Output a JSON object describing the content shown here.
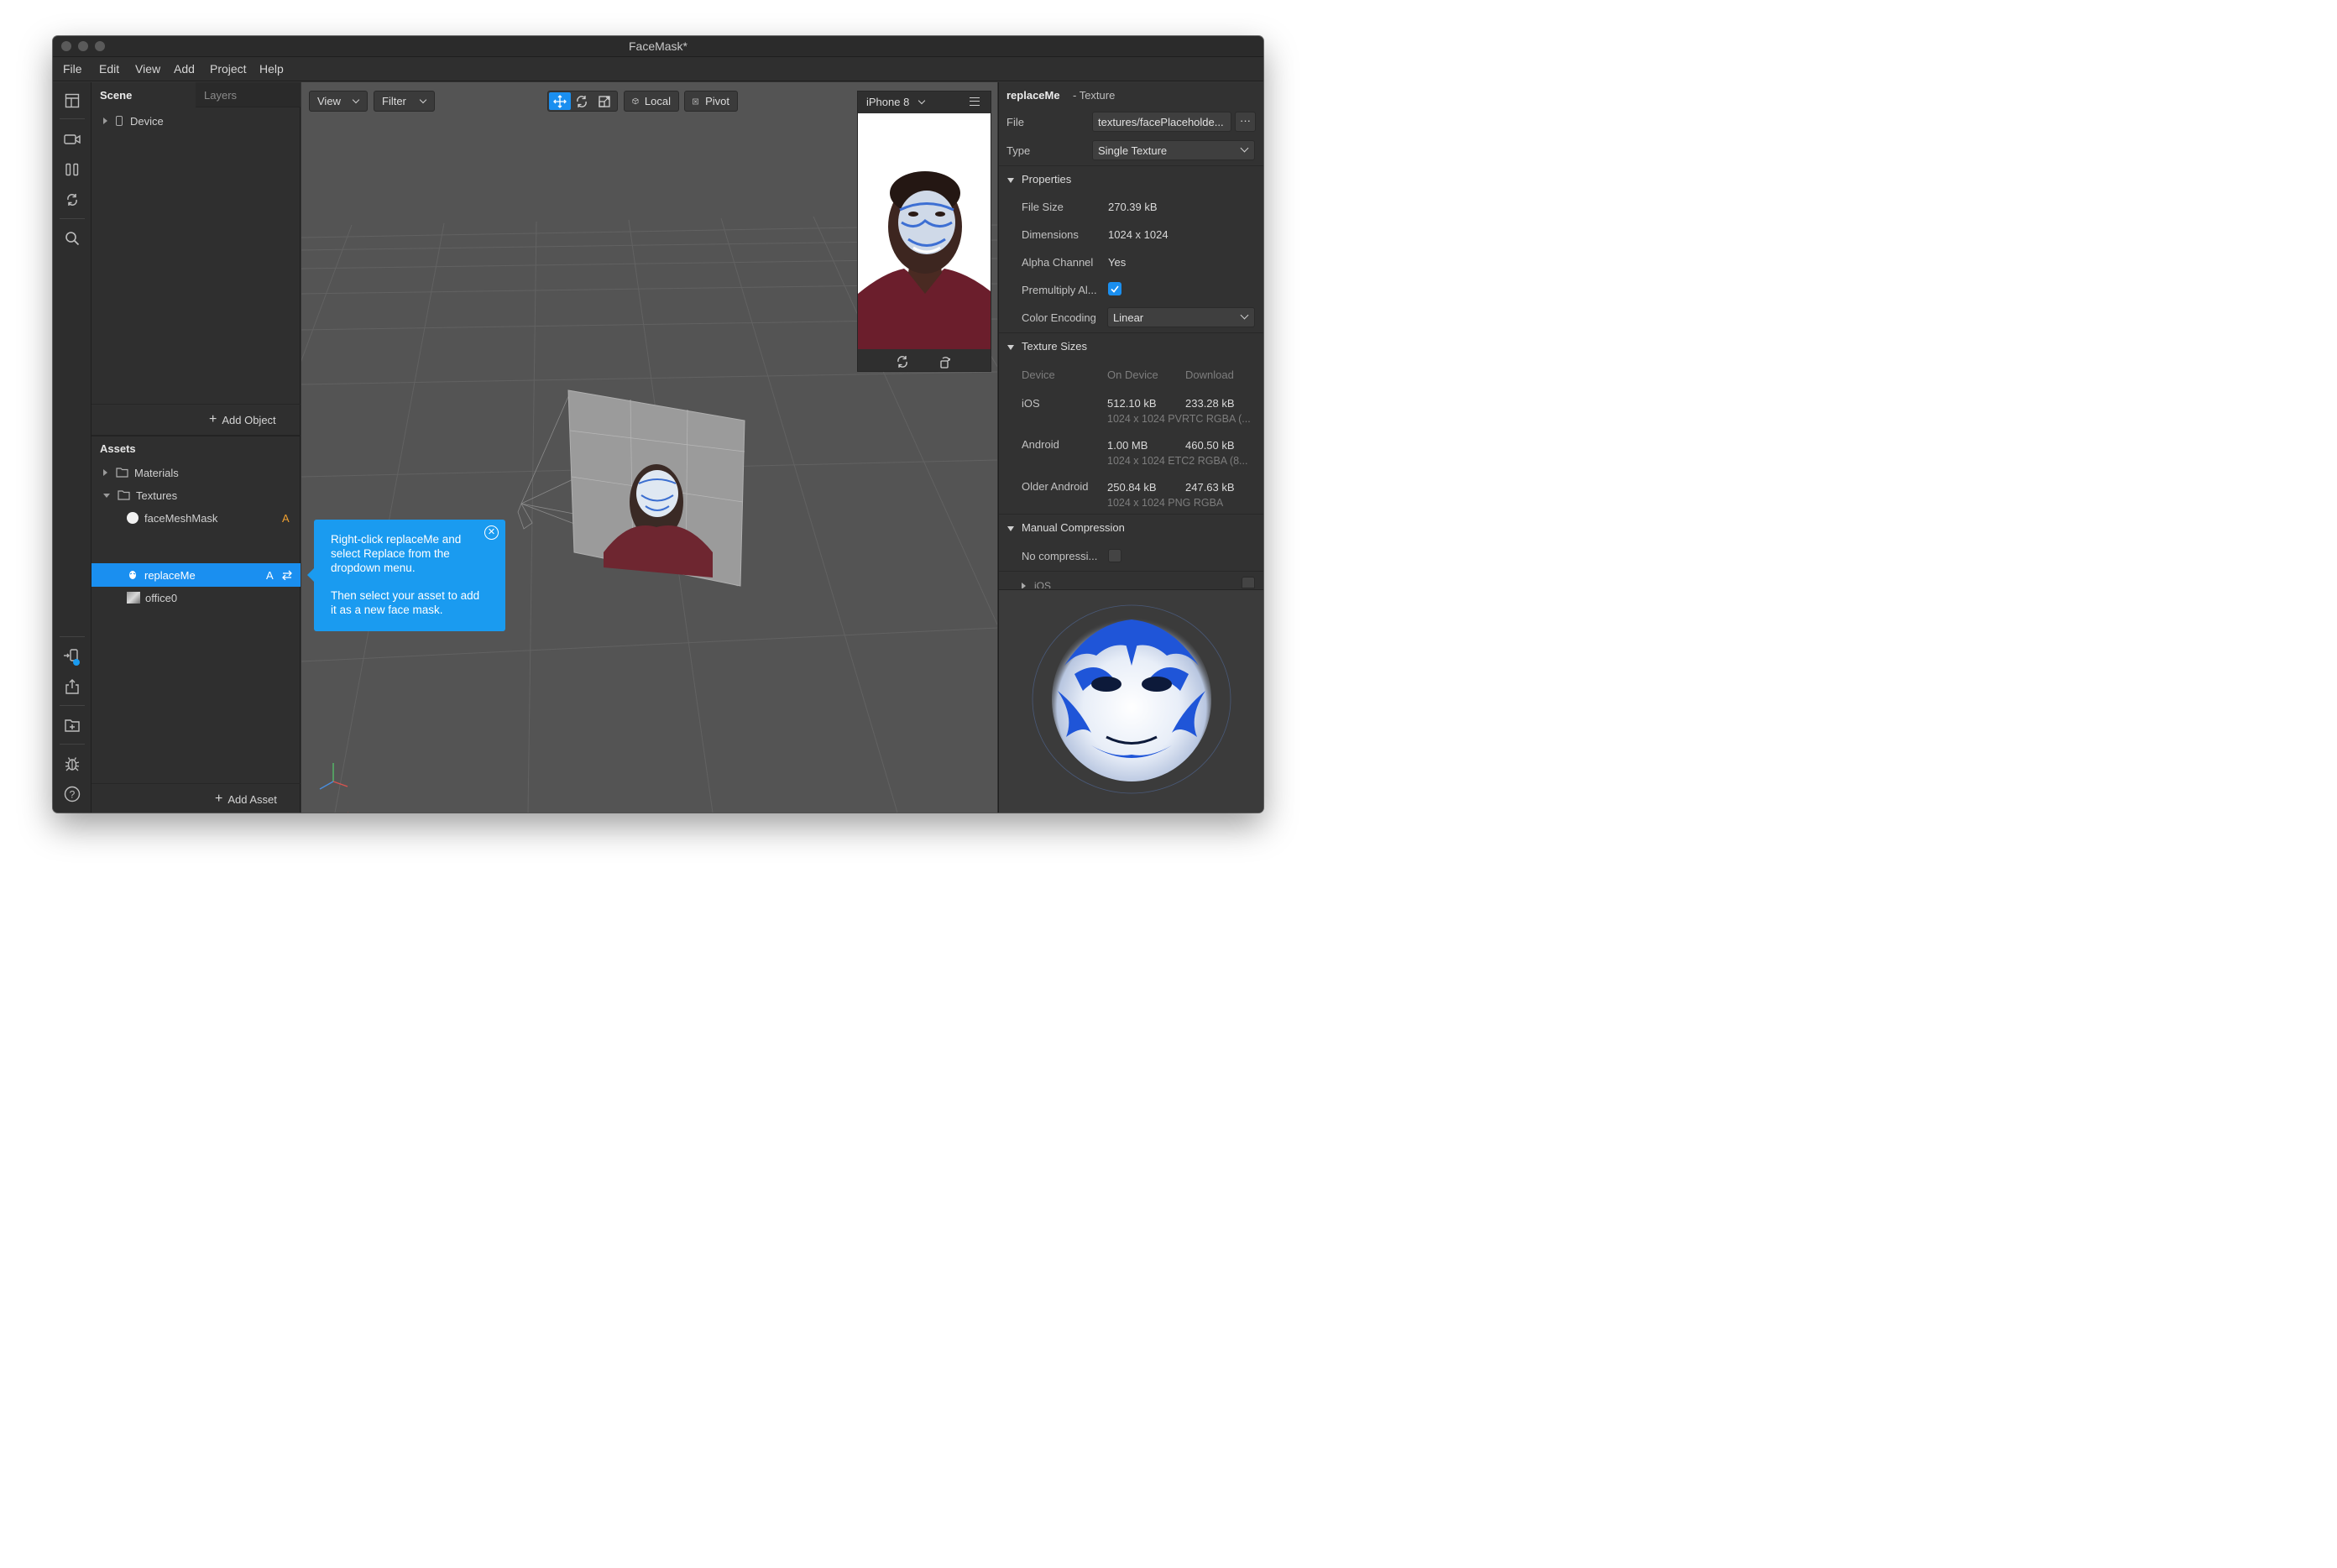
{
  "window": {
    "title": "FaceMask*"
  },
  "menu": [
    "File",
    "Edit",
    "View",
    "Add",
    "Project",
    "Help"
  ],
  "toolbar_icons": [
    "layout-icon",
    "video-camera-icon",
    "pause-columns-icon",
    "sync-icon",
    "search-icon",
    "device-connect-icon",
    "share-icon",
    "add-folder-icon",
    "bug-icon",
    "help-icon"
  ],
  "scene": {
    "tabs": [
      "Scene",
      "Layers"
    ],
    "items": [
      {
        "label": "Device"
      }
    ],
    "add_object": "Add Object"
  },
  "assets": {
    "title": "Assets",
    "items": [
      {
        "label": "Materials",
        "badge": ""
      },
      {
        "label": "Textures",
        "badge": ""
      },
      {
        "label": "faceMeshMask",
        "badge": "A"
      },
      {
        "label": "replaceMe",
        "badge": "A"
      },
      {
        "label": "office0",
        "badge": ""
      }
    ],
    "add_asset": "Add Asset"
  },
  "viewport": {
    "view_button": "View",
    "filter_button": "Filter",
    "local_button": "Local",
    "pivot_button": "Pivot",
    "tooltip": {
      "line1": "Right-click replaceMe and select Replace from the dropdown menu.",
      "line2": "Then select your asset to add it as a new face mask."
    }
  },
  "preview": {
    "device": "iPhone 8"
  },
  "inspector": {
    "name": "replaceMe",
    "type_label": "- Texture",
    "file_label": "File",
    "file_value": "textures/facePlaceholde...",
    "type_field_label": "Type",
    "type_value": "Single Texture",
    "properties_header": "Properties",
    "properties": [
      {
        "label": "File Size",
        "value": "270.39 kB"
      },
      {
        "label": "Dimensions",
        "value": "1024 x 1024"
      },
      {
        "label": "Alpha Channel",
        "value": "Yes"
      },
      {
        "label": "Premultiply Al...",
        "value": ""
      },
      {
        "label": "Color Encoding",
        "value": "Linear"
      }
    ],
    "premultiply_checked": true,
    "texture_sizes_header": "Texture Sizes",
    "sizes_columns": [
      "Device",
      "On Device",
      "Download"
    ],
    "sizes": [
      {
        "device": "iOS",
        "on_device": "512.10 kB",
        "download": "233.28 kB",
        "detail": "1024 x 1024 PVRTC RGBA (..."
      },
      {
        "device": "Android",
        "on_device": "1.00 MB",
        "download": "460.50 kB",
        "detail": "1024 x 1024 ETC2 RGBA (8..."
      },
      {
        "device": "Older Android",
        "on_device": "250.84 kB",
        "download": "247.63 kB",
        "detail": "1024 x 1024 PNG RGBA"
      }
    ],
    "manual_header": "Manual Compression",
    "no_compression": "No compressi...",
    "ios_sub": "iOS"
  },
  "colors": {
    "accent": "#1a9bf0",
    "badge": "#f0a030",
    "selection": "#1a8ff0"
  }
}
